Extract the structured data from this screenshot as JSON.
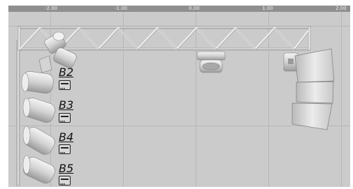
{
  "ruler": {
    "ticks": [
      "-2.00",
      "-1.00",
      "0.00",
      "1.00",
      "2.00"
    ]
  },
  "labels": {
    "b2": "B2",
    "b3": "B3",
    "b4": "B4",
    "b5": "B5"
  },
  "icons": {
    "bar_fixture": "light-bar-icon"
  },
  "colors": {
    "background": "#cbcbcb",
    "ruler": "#8f8f8f",
    "truss": "#e4e4e4",
    "fixture": "#e0e0e0"
  }
}
